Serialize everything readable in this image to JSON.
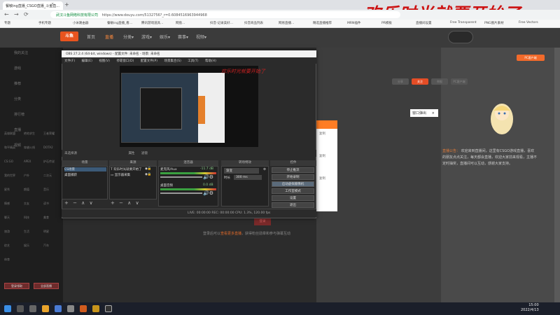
{
  "browser": {
    "tab_title": "餐敏ing直播_CSGO直播_斗鱼直...",
    "tab_close": "×",
    "new_tab": "+",
    "url_prefix": "武汉斗鱼网络科技有限公司",
    "url": "https://www.douyu.com/5132756?_r=0.6084516963944968",
    "back": "←",
    "forward": "→",
    "reload": "⟳",
    "bookmarks": [
      "专题",
      "手机专题",
      "小米路由器",
      "餐敏ing直播_看…",
      "腾讯游戏道具…",
      "网盘…",
      "抖音-记录美好…",
      "抖音商品列表",
      "网易直播…",
      "精选直播推荐",
      "MRN插件",
      "PR模板",
      "直播间设置",
      "Free Transparent",
      "PNG图片素材",
      "Free Vectors"
    ]
  },
  "overlay_banner": "欢乐时光就要开始了",
  "site": {
    "logo": "斗鱼",
    "nav": [
      "首页",
      "直播",
      "分类▾",
      "游戏▾",
      "娱乐▾",
      "赛事▾",
      "视频▾"
    ],
    "active_nav_index": 1,
    "sidebar": [
      "我的关注",
      "游戏",
      "推荐",
      "分类",
      "排行榜",
      "直播",
      "视频"
    ],
    "sidebar_tiles": [
      "英雄联盟",
      "绝地求生",
      "王者荣耀",
      "和平精英",
      "穿越火线",
      "DOTA2",
      "CS:GO",
      "APEX",
      "炉石传说",
      "我的世界",
      "户外",
      "二次元",
      "星秀",
      "颜值",
      "音乐",
      "情感",
      "交友",
      "读书",
      "聊天",
      "科技",
      "美食",
      "旅游",
      "生活",
      "明星",
      "综艺",
      "娱乐",
      "汽车",
      "体育"
    ],
    "sidebar_buttons": [
      "登录领取",
      "全部直播"
    ],
    "right_buttons": [
      "分享",
      "关注",
      "举报",
      "PC客户端"
    ],
    "popup": "窗口弹出",
    "popup_close": "×",
    "notice_title": "直播公告：",
    "notice_text": "欢迎来到直播间，这里有CSGO游戏直播，喜欢的朋友点点关注，每天都会直播，欢迎大家前来观看，主播不定时抽奖，直播间可以互动，感谢大家支持。",
    "share_label": "复制",
    "login_btn": "登录",
    "bottom_text": "登录后可以",
    "bottom_link": "查看更多直播",
    "bottom_text2": "，获得粉丝勋章和参与弹幕互动"
  },
  "obs": {
    "title": "OBS 27.2.4 (64-bit, windows) - 配置文件: 未命名 - 场景: 未命名",
    "menu": [
      "文件(F)",
      "编辑(E)",
      "视图(V)",
      "停靠窗口(D)",
      "配置文件(P)",
      "场景集合(S)",
      "工具(T)",
      "帮助(H)"
    ],
    "preview_banner": "欢乐时光就要开始了",
    "scene_bar_label": "未选择源",
    "props": "属性",
    "filters": "滤镜",
    "dock_headers": [
      "场景",
      "来源",
      "混音器",
      "转场特效",
      "控件"
    ],
    "scenes": [
      "CS场景",
      "桌面捕获"
    ],
    "sources": [
      "欢乐时光就要开始了",
      "显示器采集"
    ],
    "mixer": [
      {
        "name": "麦克风/Aux",
        "db": "-11.7 dB"
      },
      {
        "name": "桌面音频",
        "db": "0.0 dB"
      }
    ],
    "transition_type": "渐变",
    "transition_duration_label": "时长",
    "transition_duration": "300 ms",
    "controls": [
      "停止推流",
      "开始录制",
      "启动虚拟摄像机",
      "工作室模式",
      "设置",
      "退出"
    ],
    "controls_selected_index": 2,
    "dock_tools": "+ − ∧ ∨",
    "status": "LIVE: 00:00:00   REC: 00:00:00   CPU: 1.3%, 120.00 fps"
  },
  "taskbar": {
    "time": "15:00",
    "date": "2022/4/13"
  }
}
